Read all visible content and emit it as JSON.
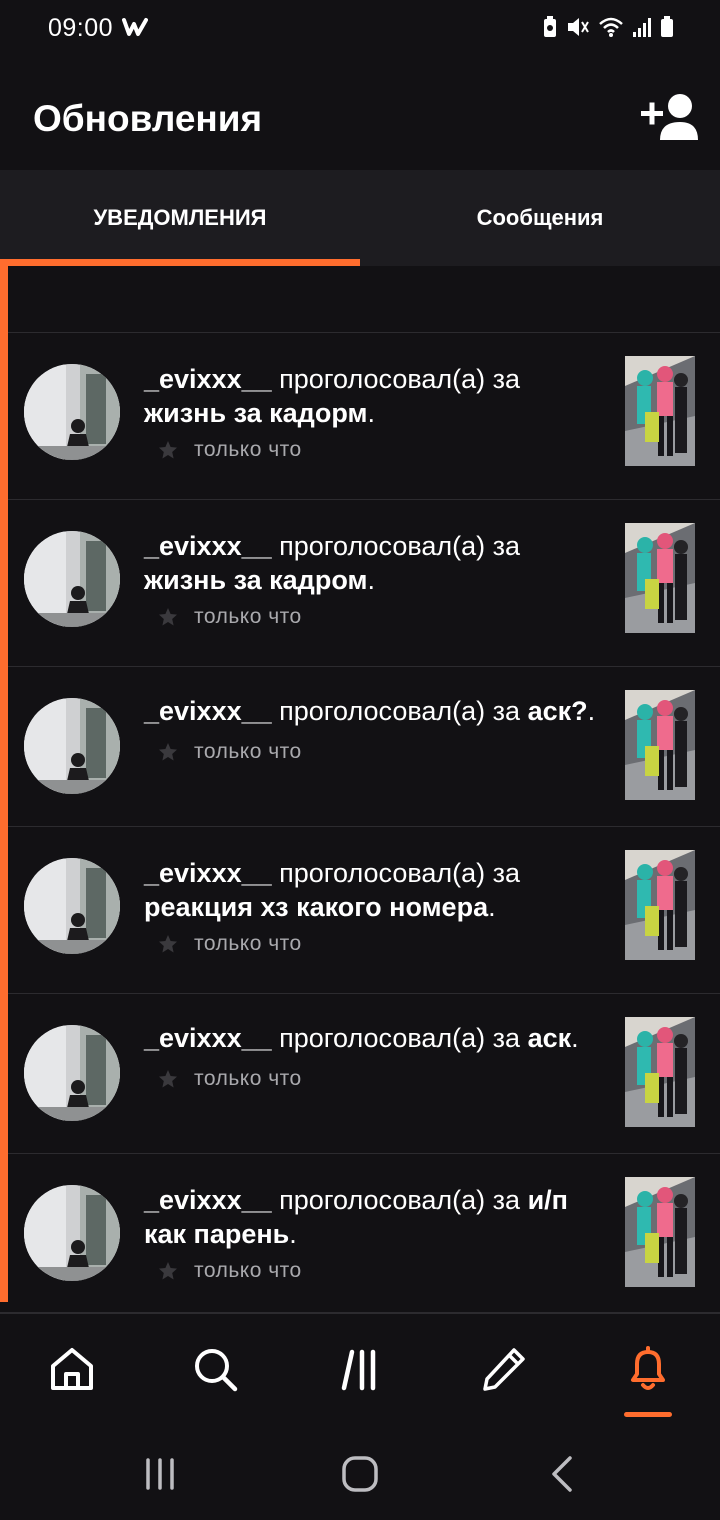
{
  "status_bar": {
    "time": "09:00",
    "app_icon": "w",
    "icons": [
      "battery-saver-icon",
      "mute-icon",
      "wifi-icon",
      "signal-icon",
      "battery-icon"
    ]
  },
  "header": {
    "title": "Обновления",
    "add_friend_icon": "add-person-icon"
  },
  "tabs": [
    {
      "label": "УВЕДОМЛЕНИЯ",
      "active": true
    },
    {
      "label": "Сообщения",
      "active": false
    }
  ],
  "accent_color": "#ff6d2e",
  "notifications": [
    {
      "user": "",
      "action": "",
      "story": "",
      "time": "только что"
    },
    {
      "user": "_evixxx__",
      "action": " проголосовал(а) за ",
      "story": "жизнь за кадорм",
      "end": ".",
      "time": "только что"
    },
    {
      "user": "_evixxx__",
      "action": " проголосовал(а) за ",
      "story": "жизнь за кадром",
      "end": ".",
      "time": "только что"
    },
    {
      "user": "_evixxx__",
      "action": " проголосовал(а) за ",
      "story": "аск?",
      "end": ".",
      "time": "только что"
    },
    {
      "user": "_evixxx__",
      "action": " проголосовал(а) за ",
      "story": "реакция хз какого номера",
      "end": ".",
      "time": "только что"
    },
    {
      "user": "_evixxx__",
      "action": " проголосовал(а) за ",
      "story": "аск",
      "end": ".",
      "time": "только что"
    },
    {
      "user": "_evixxx__",
      "action": " проголосовал(а) за ",
      "story": "и/п как парень",
      "end": ".",
      "time": "только что"
    }
  ],
  "bottom_nav": [
    {
      "name": "home-icon",
      "active": false
    },
    {
      "name": "search-icon",
      "active": false
    },
    {
      "name": "library-icon",
      "active": false
    },
    {
      "name": "write-icon",
      "active": false
    },
    {
      "name": "bell-icon",
      "active": true
    }
  ],
  "system_nav": [
    "recent-apps-icon",
    "home-button-icon",
    "back-icon"
  ]
}
